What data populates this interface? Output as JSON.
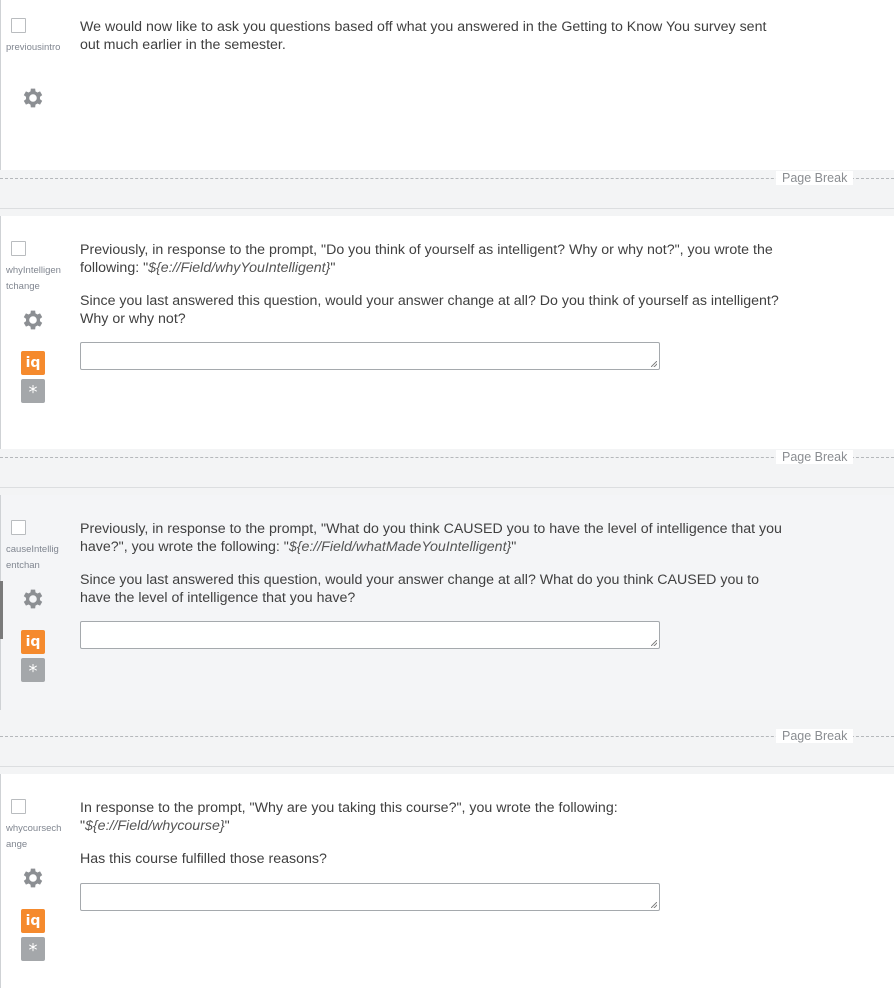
{
  "blocks": [
    {
      "id": "previousintro",
      "paragraphs": [
        "We would now like to ask you questions based off what you answered in the Getting to Know You survey sent out much earlier in the semester."
      ]
    },
    {
      "id": "whyIntelligentchange",
      "prompt_prefix": "Previously, in response to the prompt, \"Do you think of yourself as intelligent? Why or why not?\", you wrote the following: \"",
      "piped_field": "${e://Field/whyYouIntelligent}",
      "prompt_suffix": "\"",
      "question": "Since you last answered this question, would your answer change at all? Do you think of yourself as intelligent? Why or why not?"
    },
    {
      "id": "causeIntelligentchan",
      "prompt_prefix": "Previously, in response to the prompt, \"What do you think CAUSED you to have the level of intelligence that you have?\", you wrote the following: \"",
      "piped_field": "${e://Field/whatMadeYouIntelligent}",
      "prompt_suffix": "\"",
      "question": "Since you last answered this question, would your answer change at all? What do you think CAUSED you to have the level of intelligence that you have?"
    },
    {
      "id": "whycoursechange",
      "prompt_prefix": "In response to the prompt, \"Why are you taking this course?\", you wrote the following: \"",
      "piped_field": "${e://Field/whycourse}",
      "prompt_suffix": "\"",
      "question": "Has this course fulfilled those reasons?"
    }
  ],
  "page_break_label": "Page Break",
  "icons": {
    "gear": "gear-icon",
    "iq": "iq",
    "required": "*"
  },
  "colors": {
    "iq_badge": "#f58a2d",
    "required_badge": "#a4a7aa",
    "gear": "#8c8f93"
  }
}
